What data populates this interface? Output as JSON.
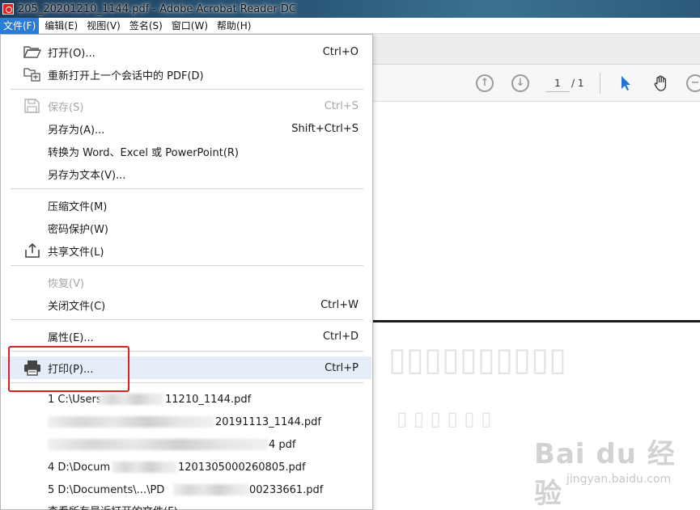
{
  "window": {
    "title": "205_20201210_1144.pdf - Adobe Acrobat Reader DC"
  },
  "menubar": [
    {
      "label": "文件(F)",
      "active": true
    },
    {
      "label": "编辑(E)"
    },
    {
      "label": "视图(V)"
    },
    {
      "label": "签名(S)"
    },
    {
      "label": "窗口(W)"
    },
    {
      "label": "帮助(H)"
    }
  ],
  "toolbar": {
    "page_current": "1",
    "page_total": "/ 1"
  },
  "file_menu": {
    "open": {
      "label": "打开(O)...",
      "shortcut": "Ctrl+O",
      "icon": "folder-open-icon"
    },
    "reopen": {
      "label": "重新打开上一个会话中的 PDF(D)",
      "icon": "reopen-session-icon"
    },
    "save": {
      "label": "保存(S)",
      "shortcut": "Ctrl+S",
      "icon": "save-icon",
      "disabled": true
    },
    "save_as": {
      "label": "另存为(A)...",
      "shortcut": "Shift+Ctrl+S"
    },
    "convert": {
      "label": "转换为 Word、Excel 或 PowerPoint(R)"
    },
    "save_as_text": {
      "label": "另存为文本(V)..."
    },
    "compress": {
      "label": "压缩文件(M)"
    },
    "protect": {
      "label": "密码保护(W)"
    },
    "share": {
      "label": "共享文件(L)",
      "icon": "share-icon"
    },
    "revert": {
      "label": "恢复(V)",
      "disabled": true
    },
    "close": {
      "label": "关闭文件(C)",
      "shortcut": "Ctrl+W"
    },
    "properties": {
      "label": "属性(E)...",
      "shortcut": "Ctrl+D"
    },
    "print": {
      "label": "打印(P)...",
      "shortcut": "Ctrl+P",
      "icon": "printer-icon"
    },
    "recent": [
      {
        "prefix": "1 C:\\Users",
        "suffix": "11210_1144.pdf"
      },
      {
        "prefix": "",
        "suffix": "20191113_1144.pdf"
      },
      {
        "prefix": "",
        "suffix": "4 pdf"
      },
      {
        "prefix": "4 D:\\Docum",
        "suffix": "1201305000260805.pdf"
      },
      {
        "prefix": "5 D:\\Documents\\...\\PD",
        "suffix": "00233661.pdf"
      }
    ],
    "view_all_recent": {
      "label": "查看所有最近打开的文件(F)..."
    }
  },
  "watermark": {
    "brand": "Bai du 经验",
    "site": "jingyan.baidu.com"
  },
  "colors": {
    "menu_active": "#2a7cd6",
    "highlight": "#e5eef8",
    "annotation": "#e02020",
    "select_tool": "#1f73d4"
  }
}
